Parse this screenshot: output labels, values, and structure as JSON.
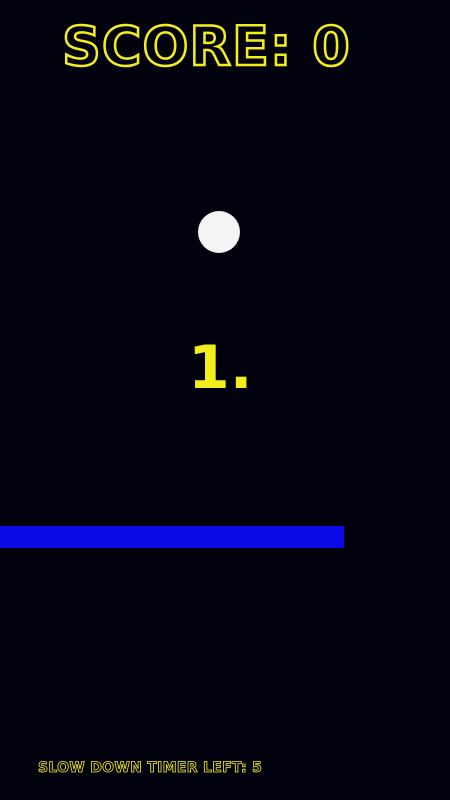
{
  "hud": {
    "score_text": "SCORE: 0",
    "countdown_text": "1.",
    "slow_down_timer_text": "SLOW DOWN TIMER LEFT: 5"
  },
  "colors": {
    "background": "#02020f",
    "text_accent": "#f2ee1c",
    "ball": "#f4f4f4",
    "paddle": "#0a0ae8"
  }
}
